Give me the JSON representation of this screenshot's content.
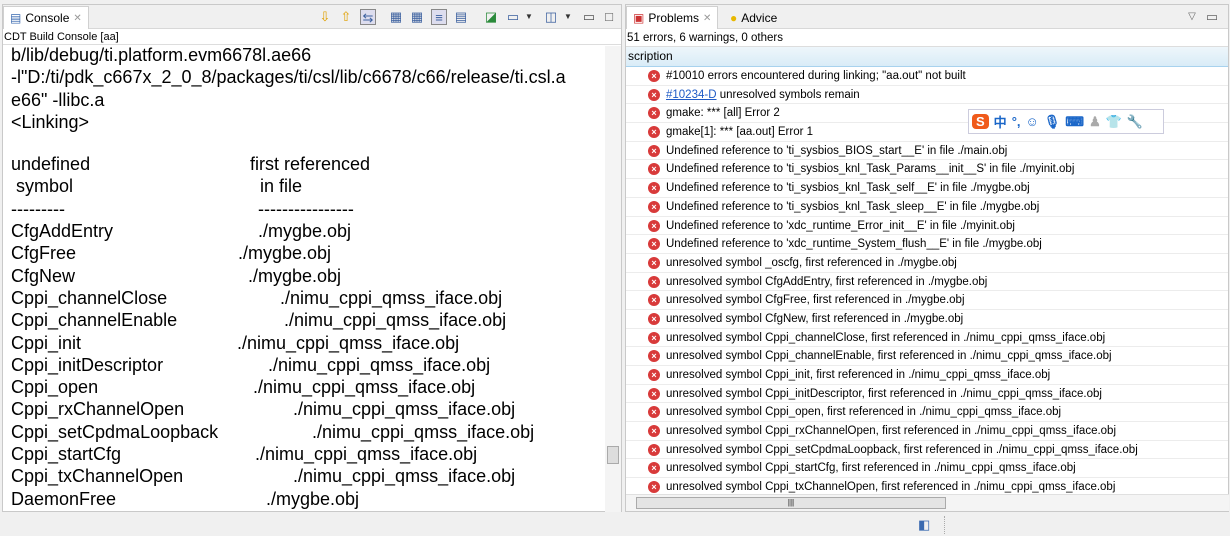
{
  "console": {
    "tab_label": "Console",
    "subtitle": "CDT Build Console [aa]",
    "lines": [
      "b/lib/debug/ti.platform.evm6678l.ae66",
      "-l\"D:/ti/pdk_c667x_2_0_8/packages/ti/csl/lib/c6678/c66/release/ti.csl.a",
      "e66\" -llibc.a",
      "<Linking>"
    ],
    "header": {
      "col1a": "undefined",
      "col2a": "first referenced",
      "col1b": " symbol",
      "col2b": "  in file",
      "dash1": "---------",
      "dash2": "----------------"
    },
    "symbols": [
      {
        "name": "CfgAddEntry",
        "file": "./mygbe.obj"
      },
      {
        "name": "CfgFree",
        "file": "./mygbe.obj"
      },
      {
        "name": "CfgNew",
        "file": "./mygbe.obj"
      },
      {
        "name": "Cppi_channelClose",
        "file": "./nimu_cppi_qmss_iface.obj"
      },
      {
        "name": "Cppi_channelEnable",
        "file": "./nimu_cppi_qmss_iface.obj"
      },
      {
        "name": "Cppi_init",
        "file": "./nimu_cppi_qmss_iface.obj"
      },
      {
        "name": "Cppi_initDescriptor",
        "file": "./nimu_cppi_qmss_iface.obj"
      },
      {
        "name": "Cppi_open",
        "file": "./nimu_cppi_qmss_iface.obj"
      },
      {
        "name": "Cppi_rxChannelOpen",
        "file": "./nimu_cppi_qmss_iface.obj"
      },
      {
        "name": "Cppi_setCpdmaLoopback",
        "file": "./nimu_cppi_qmss_iface.obj"
      },
      {
        "name": "Cppi_startCfg",
        "file": "./nimu_cppi_qmss_iface.obj"
      },
      {
        "name": "Cppi_txChannelOpen",
        "file": "./nimu_cppi_qmss_iface.obj"
      },
      {
        "name": "DaemonFree",
        "file": "./mygbe.obj"
      }
    ]
  },
  "problems": {
    "tab_label": "Problems",
    "advice_label": "Advice",
    "summary": "51 errors, 6 warnings, 0 others",
    "column": "scription",
    "rows": [
      {
        "text": "#10010 errors encountered during linking; \"aa.out\" not built"
      },
      {
        "link": "#10234-D",
        "text": " unresolved symbols remain"
      },
      {
        "text": "gmake: *** [all] Error 2"
      },
      {
        "text": "gmake[1]: *** [aa.out] Error 1"
      },
      {
        "text": "Undefined reference to 'ti_sysbios_BIOS_start__E' in file ./main.obj"
      },
      {
        "text": "Undefined reference to 'ti_sysbios_knl_Task_Params__init__S' in file ./myinit.obj"
      },
      {
        "text": "Undefined reference to 'ti_sysbios_knl_Task_self__E' in file ./mygbe.obj"
      },
      {
        "text": "Undefined reference to 'ti_sysbios_knl_Task_sleep__E' in file ./mygbe.obj"
      },
      {
        "text": "Undefined reference to 'xdc_runtime_Error_init__E' in file ./myinit.obj"
      },
      {
        "text": "Undefined reference to 'xdc_runtime_System_flush__E' in file ./mygbe.obj"
      },
      {
        "text": "unresolved symbol _oscfg, first referenced in ./mygbe.obj"
      },
      {
        "text": "unresolved symbol CfgAddEntry, first referenced in ./mygbe.obj"
      },
      {
        "text": "unresolved symbol CfgFree, first referenced in ./mygbe.obj"
      },
      {
        "text": "unresolved symbol CfgNew, first referenced in ./mygbe.obj"
      },
      {
        "text": "unresolved symbol Cppi_channelClose, first referenced in ./nimu_cppi_qmss_iface.obj"
      },
      {
        "text": "unresolved symbol Cppi_channelEnable, first referenced in ./nimu_cppi_qmss_iface.obj"
      },
      {
        "text": "unresolved symbol Cppi_init, first referenced in ./nimu_cppi_qmss_iface.obj"
      },
      {
        "text": "unresolved symbol Cppi_initDescriptor, first referenced in ./nimu_cppi_qmss_iface.obj"
      },
      {
        "text": "unresolved symbol Cppi_open, first referenced in ./nimu_cppi_qmss_iface.obj"
      },
      {
        "text": "unresolved symbol Cppi_rxChannelOpen, first referenced in ./nimu_cppi_qmss_iface.obj"
      },
      {
        "text": "unresolved symbol Cppi_setCpdmaLoopback, first referenced in ./nimu_cppi_qmss_iface.obj"
      },
      {
        "text": "unresolved symbol Cppi_startCfg, first referenced in ./nimu_cppi_qmss_iface.obj"
      },
      {
        "text": "unresolved symbol Cppi_txChannelOpen, first referenced in ./nimu_cppi_qmss_iface.obj"
      }
    ]
  },
  "ime": {
    "mode": "中",
    "punct": "°,"
  }
}
